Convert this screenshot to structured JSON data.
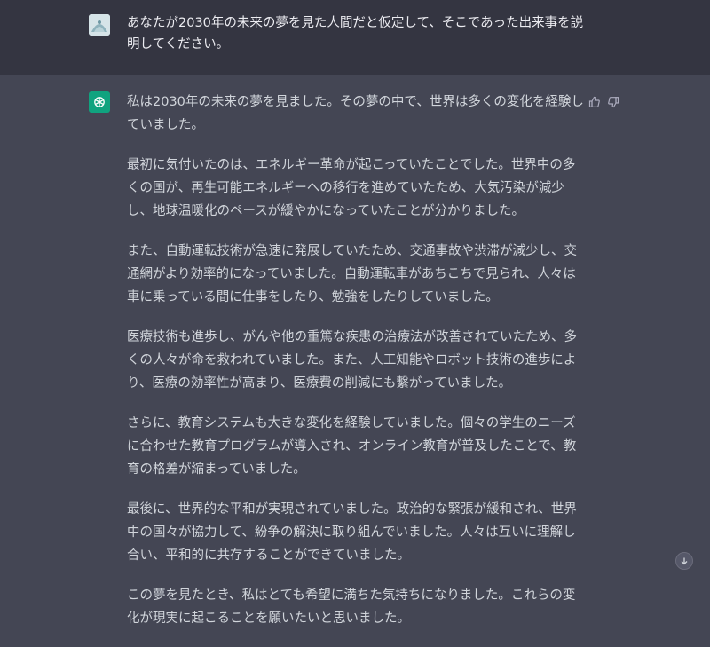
{
  "user": {
    "avatar_icon": "user-avatar-icon",
    "prompt": "あなたが2030年の未来の夢を見た人間だと仮定して、そこであった出来事を説明してください。"
  },
  "assistant": {
    "avatar_icon": "openai-logo-icon",
    "paragraphs": [
      "私は2030年の未来の夢を見ました。その夢の中で、世界は多くの変化を経験していました。",
      "最初に気付いたのは、エネルギー革命が起こっていたことでした。世界中の多くの国が、再生可能エネルギーへの移行を進めていたため、大気汚染が減少し、地球温暖化のペースが緩やかになっていたことが分かりました。",
      "また、自動運転技術が急速に発展していたため、交通事故や渋滞が減少し、交通網がより効率的になっていました。自動運転車があちこちで見られ、人々は車に乗っている間に仕事をしたり、勉強をしたりしていました。",
      "医療技術も進歩し、がんや他の重篤な疾患の治療法が改善されていたため、多くの人々が命を救われていました。また、人工知能やロボット技術の進歩により、医療の効率性が高まり、医療費の削減にも繋がっていました。",
      "さらに、教育システムも大きな変化を経験していました。個々の学生のニーズに合わせた教育プログラムが導入され、オンライン教育が普及したことで、教育の格差が縮まっていました。",
      "最後に、世界的な平和が実現されていました。政治的な緊張が緩和され、世界中の国々が協力して、紛争の解決に取り組んでいました。人々は互いに理解し合い、平和的に共存することができていました。",
      "この夢を見たとき、私はとても希望に満ちた気持ちになりました。これらの変化が現実に起こることを願いたいと思いました。"
    ],
    "feedback_icons": [
      "thumbs-up-icon",
      "thumbs-down-icon"
    ]
  },
  "controls": {
    "scroll_icon": "arrow-down-icon"
  },
  "colors": {
    "bg_user": "#343541",
    "bg_assistant": "#444654",
    "accent": "#10a37f"
  }
}
